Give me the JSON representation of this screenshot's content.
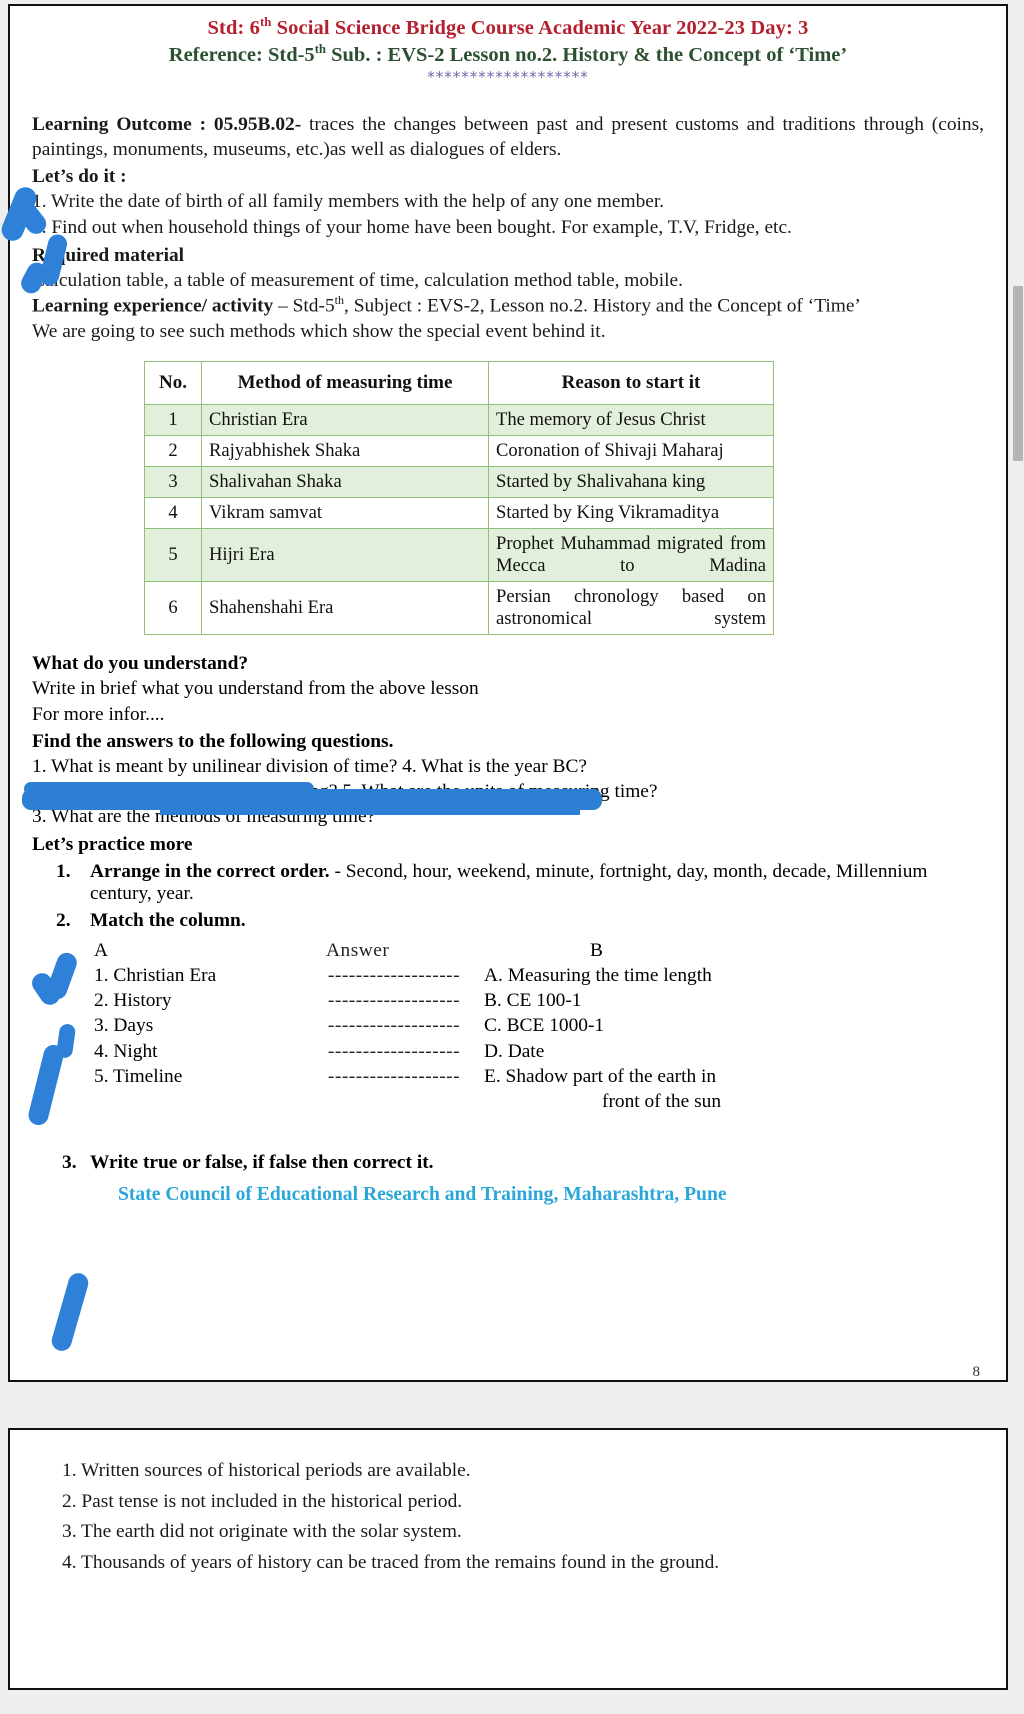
{
  "header": {
    "title_pre": "Std: 6",
    "title_sup": "th",
    "title_post": " Social Science Bridge Course Academic Year 2022-23   Day: 3",
    "reference_pre": "Reference: Std-5",
    "reference_sup": "th",
    "reference_post": " Sub. : EVS-2  Lesson no.2.  History & the Concept of ‘Time’",
    "stars": "*******************",
    "title_color": "#b5202f",
    "reference_color": "#2c5031",
    "stars_color": "#6b6aa8"
  },
  "learning_outcome": {
    "label": "Learning Outcome  :  05.95B.02-",
    "text": " traces the changes between past and present customs and traditions through (coins, paintings, monuments, museums, etc.)as well as dialogues of elders."
  },
  "lets_do_it": {
    "heading": "Let’s do it  :",
    "items": [
      "1. Write the date of birth of all family members with the help of any one member.",
      "2. Find out when household things of your home have been bought. For example, T.V, Fridge, etc."
    ]
  },
  "required_material": {
    "heading": "Required material",
    "text": "Calculation table, a table of measurement of time, calculation method table, mobile."
  },
  "learning_experience": {
    "label": "Learning experience/ activity",
    "text_pre": " – Std-5",
    "text_sup": "th",
    "text_post": ", Subject : EVS-2, Lesson no.2. History and the Concept of ‘Time’"
  },
  "intro_line": "We are going to see such methods which show the special event behind it.",
  "era_table": {
    "columns": [
      "No.",
      "Method of measuring time",
      "Reason to start it"
    ],
    "border_color": "#93bf7c",
    "shade_color": "#e2efda",
    "rows": [
      {
        "no": "1",
        "method": "Christian Era",
        "reason": "The memory of Jesus Christ"
      },
      {
        "no": "2",
        "method": "Rajyabhishek Shaka",
        "reason": "Coronation of Shivaji Maharaj"
      },
      {
        "no": "3",
        "method": "Shalivahan Shaka",
        "reason": "Started by Shalivahana king"
      },
      {
        "no": "4",
        "method": "Vikram samvat",
        "reason": "Started by King Vikramaditya"
      },
      {
        "no": "5",
        "method": "Hijri Era",
        "reason": "Prophet Muhammad migrated from Mecca to Madina"
      },
      {
        "no": "6",
        "method": "Shahenshahi Era",
        "reason": "Persian chronology based on astronomical system"
      }
    ]
  },
  "understand": {
    "heading": "What do you understand?",
    "text": "Write in brief what you understand from the above lesson",
    "redacted_line": "For more infor...."
  },
  "find_answers": {
    "heading": "Find the answers to the following questions.",
    "lines": [
      "1. What is meant by unilinear division of time?    4. What is the year BC?",
      "2. When did the earth come into being?   5. What are the units of measuring time?",
      "3. What are the methods of measuring time?"
    ]
  },
  "practice": {
    "heading": "Let’s practice more",
    "q1": {
      "num": "1.",
      "bold": "Arrange in the correct order.",
      "text": " - Second, hour, weekend, minute, fortnight, day, month, decade, Millennium century, year."
    },
    "q2": {
      "num": "2.",
      "bold": "Match the column."
    }
  },
  "match_column": {
    "head_a": "A",
    "head_answer": "Answer",
    "head_b": "B",
    "dots": "-------------------",
    "rows": [
      {
        "a": "1.  Christian Era",
        "b": "A. Measuring the time length"
      },
      {
        "a": "2.  History",
        "b": "B. CE 100-1"
      },
      {
        "a": "3.  Days",
        "b": "C. BCE 1000-1"
      },
      {
        "a": "4.  Night",
        "b": "D. Date"
      },
      {
        "a": "5.  Timeline",
        "b": "E.  Shadow part of the earth in"
      }
    ],
    "last_b_continuation": "front of the sun"
  },
  "true_false": {
    "num": "3.",
    "heading": "Write true or false, if false then correct it."
  },
  "footer": {
    "scert": "State Council of Educational Research and Training, Maharashtra, Pune",
    "scert_color": "#2aa6d8",
    "page_number": "8"
  },
  "next_page": {
    "items": [
      "1. Written sources of historical periods are available.",
      "2. Past tense is not included in the historical period.",
      "3. The earth did not originate with the solar system.",
      "4. Thousands of years of history can be traced from the remains found in the ground."
    ]
  },
  "annotations": {
    "ink_color": "#2d7fd3",
    "marks": [
      "check-mark-item-1",
      "check-mark-item-2",
      "redaction-stroke-url",
      "tick-question-1",
      "tick-question-2",
      "tick-question-3"
    ]
  }
}
